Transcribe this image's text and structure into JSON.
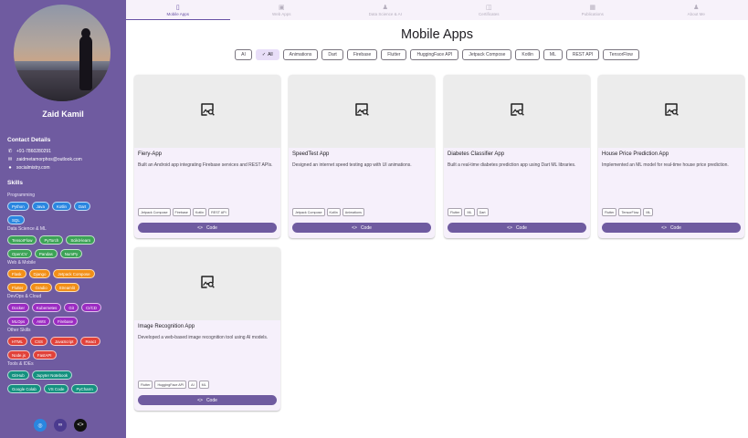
{
  "profile": {
    "name": "Zaid Kamil",
    "contact_heading": "Contact Details",
    "phone": "+91-7860280291",
    "email": "zaidmetamorphos@outlook.com",
    "website": "socialmistry.com"
  },
  "skills": {
    "heading": "Skills",
    "categories": [
      {
        "label": "Programming",
        "color": "#2a86e0",
        "rows": [
          [
            "Python",
            "Java",
            "Kotlin",
            "Dart"
          ],
          [
            "SQL"
          ]
        ]
      },
      {
        "label": "Data Science & ML",
        "color": "#3ca356",
        "rows": [
          [
            "TensorFlow",
            "PyTorch",
            "Scikit-learn"
          ],
          [
            "OpenCV",
            "Pandas",
            "NumPy"
          ]
        ]
      },
      {
        "label": "Web & Mobile",
        "color": "#f28f17",
        "rows": [
          [
            "Flask",
            "Django",
            "Jetpack Compose"
          ],
          [
            "Flutter",
            "Gradio",
            "Streamlit"
          ]
        ]
      },
      {
        "label": "DevOps & Cloud",
        "color": "#9b2cc2",
        "rows": [
          [
            "Docker",
            "Kubernetes",
            "Git",
            "CI/CD"
          ],
          [
            "MLOps",
            "AWS",
            "Firebase"
          ]
        ]
      },
      {
        "label": "Other Skills",
        "color": "#e1423a",
        "rows": [
          [
            "HTML",
            "CSS",
            "JavaScript",
            "React"
          ],
          [
            "Node.js",
            "FastAPI"
          ]
        ]
      },
      {
        "label": "Tools & IDEs",
        "color": "#14917f",
        "rows": [
          [
            "GitHub",
            "Jupyter Notebook"
          ],
          [
            "Google Colab",
            "VS Code",
            "PyCharm"
          ]
        ]
      }
    ]
  },
  "social": [
    {
      "icon": "globe-icon",
      "color": "#2a86e0"
    },
    {
      "icon": "link-icon",
      "color": "#4b3b8f"
    },
    {
      "icon": "code-icon",
      "color": "#111111"
    }
  ],
  "nav": {
    "tabs": [
      {
        "label": "Mobile Apps",
        "icon": "phone-icon",
        "active": true
      },
      {
        "label": "Web Apps",
        "icon": "web-icon",
        "active": false
      },
      {
        "label": "Data Science & AI",
        "icon": "person-icon",
        "active": false
      },
      {
        "label": "Certificates",
        "icon": "certificate-icon",
        "active": false
      },
      {
        "label": "Publications",
        "icon": "book-icon",
        "active": false
      },
      {
        "label": "About Me",
        "icon": "person-icon",
        "active": false
      }
    ]
  },
  "page_title": "Mobile Apps",
  "filters": [
    {
      "label": "AI",
      "selected": false
    },
    {
      "label": "All",
      "selected": true
    },
    {
      "label": "Animations",
      "selected": false
    },
    {
      "label": "Dart",
      "selected": false
    },
    {
      "label": "Firebase",
      "selected": false
    },
    {
      "label": "Flutter",
      "selected": false
    },
    {
      "label": "HuggingFace API",
      "selected": false
    },
    {
      "label": "Jetpack Compose",
      "selected": false
    },
    {
      "label": "Kotlin",
      "selected": false
    },
    {
      "label": "ML",
      "selected": false
    },
    {
      "label": "REST API",
      "selected": false
    },
    {
      "label": "TensorFlow",
      "selected": false
    }
  ],
  "code_label": "Code",
  "projects": [
    {
      "title": "Fiery-App",
      "description": "Built an Android app integrating Firebase services and REST APIs.",
      "tags": [
        "Jetpack Compose",
        "Firebase",
        "Kotlin",
        "REST API"
      ]
    },
    {
      "title": "SpeedTest App",
      "description": "Designed an internet speed testing app with UI animations.",
      "tags": [
        "Jetpack Compose",
        "Kotlin",
        "Animations"
      ]
    },
    {
      "title": "Diabetes Classifier App",
      "description": "Built a real-time diabetes prediction app using Dart ML libraries.",
      "tags": [
        "Flutter",
        "ML",
        "Dart"
      ]
    },
    {
      "title": "House Price Prediction App",
      "description": "Implemented an ML model for real-time house price prediction.",
      "tags": [
        "Flutter",
        "TensorFlow",
        "ML"
      ]
    },
    {
      "title": "Image Recognition App",
      "description": "Developed a web-based image recognition tool using AI models.",
      "tags": [
        "Flutter",
        "HuggingFace API",
        "AI",
        "ML"
      ]
    }
  ]
}
